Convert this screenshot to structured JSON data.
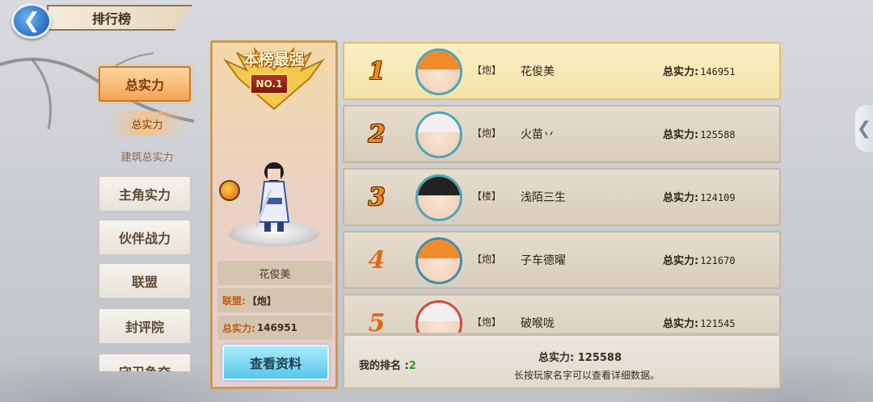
{
  "header": {
    "back_glyph": "❮",
    "title": "排行榜"
  },
  "nav": {
    "items": [
      {
        "label": "总实力",
        "active": true
      },
      {
        "label": "主角实力"
      },
      {
        "label": "伙伴战力"
      },
      {
        "label": "联盟"
      },
      {
        "label": "封评院"
      },
      {
        "label": "守卫争夺"
      }
    ],
    "sub_items": [
      {
        "label": "总实力",
        "active": true
      },
      {
        "label": "建筑总实力"
      }
    ]
  },
  "featured": {
    "crest_title": "本榜最强",
    "badge": "NO.1",
    "name": "花俊美",
    "alliance_label": "联盟:",
    "alliance_value": "【炮】",
    "power_label": "总实力:",
    "power_value": "146951",
    "view_button": "查看资料"
  },
  "ranking": [
    {
      "rank": "1",
      "guild": "【炮】",
      "name": "花俊美",
      "power_label": "总实力:",
      "power": "146951",
      "hair": "#f08a2a",
      "ring": "#4ea6b8"
    },
    {
      "rank": "2",
      "guild": "【炮】",
      "name": "火苗丷",
      "power_label": "总实力:",
      "power": "125588",
      "hair": "#f3eef0",
      "ring": "#4ea6b8"
    },
    {
      "rank": "3",
      "guild": "【楼】",
      "name": "浅陌三生",
      "power_label": "总实力:",
      "power": "124109",
      "hair": "#222222",
      "ring": "#4ea6b8"
    },
    {
      "rank": "4",
      "guild": "【炮】",
      "name": "子车德曜",
      "power_label": "总实力:",
      "power": "121670",
      "hair": "#f08a2a",
      "ring": "#3e8fa8"
    },
    {
      "rank": "5",
      "guild": "【炮】",
      "name": "破喉咙",
      "power_label": "总实力:",
      "power": "121545",
      "hair": "#f3eef0",
      "ring": "#d04a3a"
    }
  ],
  "my_rank": {
    "label": "我的排名 :",
    "value": "2",
    "power_label": "总实力:",
    "power_value": "125588",
    "hint": "长按玩家名字可以查看详细数据。"
  },
  "side_arrow_glyph": "❮"
}
